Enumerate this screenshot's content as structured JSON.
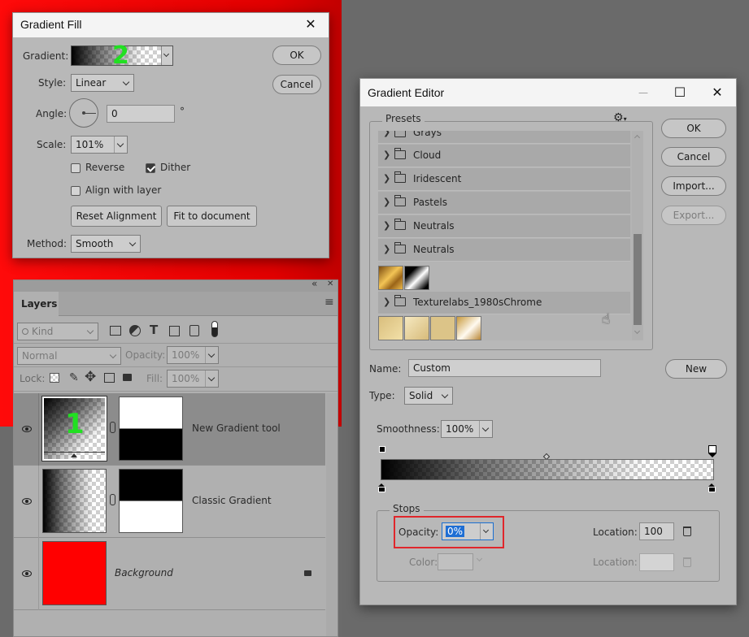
{
  "gradient_fill": {
    "title": "Gradient Fill",
    "close_glyph": "✕",
    "gradient_label": "Gradient:",
    "style_label": "Style:",
    "style_value": "Linear",
    "angle_label": "Angle:",
    "angle_value": "0",
    "degree_symbol": "°",
    "scale_label": "Scale:",
    "scale_value": "101%",
    "reverse_label": "Reverse",
    "dither_label": "Dither",
    "align_label": "Align with layer",
    "reset_alignment": "Reset Alignment",
    "fit_to_document": "Fit to document",
    "method_label": "Method:",
    "method_value": "Smooth",
    "ok": "OK",
    "cancel": "Cancel",
    "annotation": "2"
  },
  "layers_panel": {
    "tab": "Layers",
    "kind_label": "Kind",
    "blend_mode": "Normal",
    "opacity_label": "Opacity:",
    "opacity_value": "100%",
    "lock_label": "Lock:",
    "fill_label": "Fill:",
    "fill_value": "100%",
    "collapse_glyph": "«",
    "close_glyph": "✕",
    "menu_glyph": "≡",
    "layers": [
      {
        "name": "New Gradient tool",
        "annotation": "1"
      },
      {
        "name": "Classic Gradient"
      },
      {
        "name": "Background"
      }
    ]
  },
  "gradient_editor": {
    "title": "Gradient Editor",
    "minimize_glyph": "—",
    "maximize_glyph": "☐",
    "close_glyph": "✕",
    "presets_label": "Presets",
    "preset_folders": [
      "Grays",
      "Cloud",
      "Iridescent",
      "Pastels",
      "Neutrals",
      "Neutrals"
    ],
    "texture_folder": "Texturelabs_1980sChrome",
    "ok": "OK",
    "cancel": "Cancel",
    "import": "Import...",
    "export": "Export...",
    "name_label": "Name:",
    "name_value": "Custom",
    "new_button": "New",
    "type_label": "Type:",
    "type_value": "Solid",
    "smoothness_label": "Smoothness:",
    "smoothness_value": "100%",
    "stops_label": "Stops",
    "stop_opacity_label": "Opacity:",
    "stop_opacity_value": "0%",
    "location_label": "Location:",
    "location_value": "100",
    "color_label": "Color:",
    "color_location_label": "Location:",
    "highlight_color": "#e0262b"
  }
}
